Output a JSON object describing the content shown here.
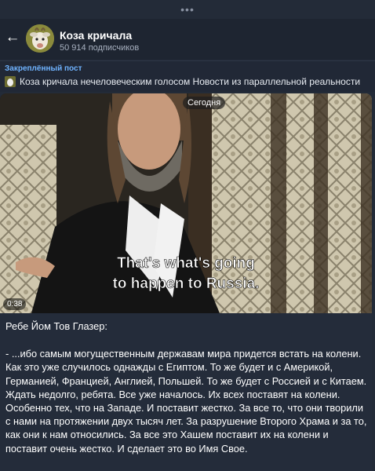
{
  "top_indicator": "•••",
  "header": {
    "back_icon": "arrow-left-icon",
    "title": "Коза кричала",
    "subscribers": "50 914 подписчиков"
  },
  "pinned": {
    "label": "Закреплённый пост",
    "text": "Коза кричала нечеловеческим голосом Новости из параллельной реальности"
  },
  "post": {
    "date_chip": "Сегодня",
    "video": {
      "duration": "0:38",
      "subtitle_line1": "That's what's going",
      "subtitle_line2": "to happen to Russia."
    },
    "author_line": "Ребе Йом Тов Глазер:",
    "body": "- ...ибо самым могущественным державам мира придется встать на колени. Как это уже случилось однажды с Египтом. То же будет и с Америкой, Германией, Францией, Англией, Польшей. То же будет с Россией и с Китаем. Ждать недолго, ребята. Все уже началось. Их всех поставят на колени. Особенно тех, что на Западе. И поставит жестко. За все то, что они творили с нами на протяжении двух тысяч лет. За разрушение Второго Храма и за то, как они к нам относились. За все это Хашем поставит их на колени и поставит очень жестко. И сделает это во Имя Своe."
  },
  "colors": {
    "background": "#232b38",
    "header": "#1e2531",
    "pinned_label": "#6fb3ff",
    "subtitle_text": "#ffffff"
  }
}
